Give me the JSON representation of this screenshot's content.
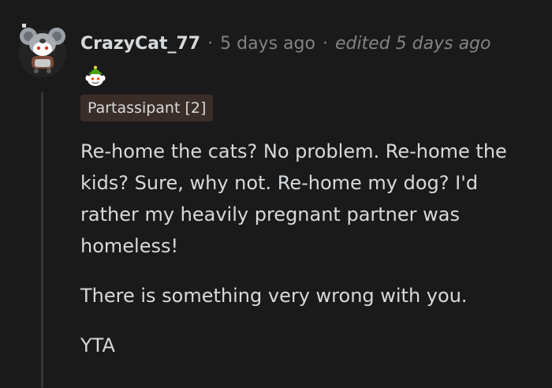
{
  "comment": {
    "username": "CrazyCat_77",
    "separator": "·",
    "timestamp": "5 days ago",
    "edited": "edited 5 days ago",
    "flair": "Partassipant [2]",
    "paragraphs": [
      "Re-home the cats? No problem. Re-home the kids? Sure, why not. Re-home my dog? I'd rather my heavily pregnant partner was homeless!",
      "There is something very wrong with you.",
      "YTA"
    ]
  },
  "icons": {
    "avatar": "koala-snoo-avatar-icon",
    "award": "elf-snoo-award-icon"
  },
  "colors": {
    "background": "#1a1a1b",
    "text": "#d7dadc",
    "meta": "#818384",
    "flair_bg": "#3a2d27",
    "thread_line": "#343536"
  }
}
